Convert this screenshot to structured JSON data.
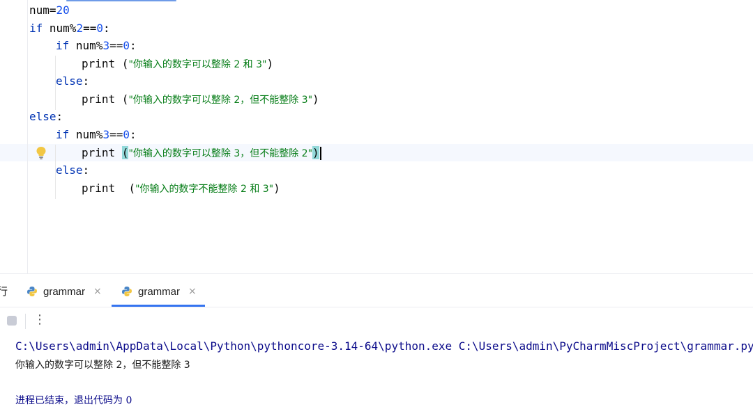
{
  "code_lines": [
    {
      "id": "l1",
      "tokens": [
        {
          "t": "num=",
          "c": "plain"
        },
        {
          "t": "20",
          "c": "num"
        }
      ]
    },
    {
      "id": "l2",
      "tokens": [
        {
          "t": "if ",
          "c": "kw"
        },
        {
          "t": "num%",
          "c": "plain"
        },
        {
          "t": "2",
          "c": "num"
        },
        {
          "t": "==",
          "c": "plain"
        },
        {
          "t": "0",
          "c": "num"
        },
        {
          "t": ":",
          "c": "plain"
        }
      ]
    },
    {
      "id": "l3",
      "tokens": [
        {
          "t": "if ",
          "c": "kw"
        },
        {
          "t": "num%",
          "c": "plain"
        },
        {
          "t": "3",
          "c": "num"
        },
        {
          "t": "==",
          "c": "plain"
        },
        {
          "t": "0",
          "c": "num"
        },
        {
          "t": ":",
          "c": "plain"
        }
      ]
    },
    {
      "id": "l4",
      "tokens": [
        {
          "t": "print ",
          "c": "plain"
        },
        {
          "t": "(",
          "c": "plain"
        },
        {
          "t": "\"你输入的数字可以整除 2 和 3\"",
          "c": "str"
        },
        {
          "t": ")",
          "c": "plain"
        }
      ]
    },
    {
      "id": "l5",
      "tokens": [
        {
          "t": "else",
          "c": "kw"
        },
        {
          "t": ":",
          "c": "plain"
        }
      ]
    },
    {
      "id": "l6",
      "tokens": [
        {
          "t": "print ",
          "c": "plain"
        },
        {
          "t": "(",
          "c": "plain"
        },
        {
          "t": "\"你输入的数字可以整除 2，但不能整除 3\"",
          "c": "str"
        },
        {
          "t": ")",
          "c": "plain"
        }
      ]
    },
    {
      "id": "l7",
      "tokens": [
        {
          "t": "else",
          "c": "kw"
        },
        {
          "t": ":",
          "c": "plain"
        }
      ]
    },
    {
      "id": "l8",
      "tokens": [
        {
          "t": "if ",
          "c": "kw"
        },
        {
          "t": "num%",
          "c": "plain"
        },
        {
          "t": "3",
          "c": "num"
        },
        {
          "t": "==",
          "c": "plain"
        },
        {
          "t": "0",
          "c": "num"
        },
        {
          "t": ":",
          "c": "plain"
        }
      ]
    },
    {
      "id": "l9",
      "tokens": [
        {
          "t": "print ",
          "c": "plain"
        },
        {
          "t": "(",
          "c": "brace"
        },
        {
          "t": "\"你输入的数字可以整除 3，但不能整除 2\"",
          "c": "str"
        },
        {
          "t": ")",
          "c": "brace"
        }
      ]
    },
    {
      "id": "l10",
      "tokens": [
        {
          "t": "else",
          "c": "kw"
        },
        {
          "t": ":",
          "c": "plain"
        }
      ]
    },
    {
      "id": "l11",
      "tokens": [
        {
          "t": "print  ",
          "c": "plain"
        },
        {
          "t": "(",
          "c": "plain"
        },
        {
          "t": "\"你输入的数字不能整除 2 和 3\"",
          "c": "str"
        },
        {
          "t": ")",
          "c": "plain"
        }
      ]
    }
  ],
  "run_panel": {
    "title": "行",
    "tabs": [
      {
        "label": "grammar",
        "icon": "python-icon",
        "close": "×",
        "active": false
      },
      {
        "label": "grammar",
        "icon": "python-icon",
        "close": "×",
        "active": true
      }
    ],
    "toolbar": {
      "more": "⋮"
    }
  },
  "console": {
    "command": "C:\\Users\\admin\\AppData\\Local\\Python\\pythoncore-3.14-64\\python.exe C:\\Users\\admin\\PyCharmMiscProject\\grammar.py",
    "output": "你输入的数字可以整除 2，但不能整除 3",
    "exit": "进程已结束，退出代码为 0"
  },
  "colors": {
    "keyword": "#0033b3",
    "number": "#1750eb",
    "string": "#067d17",
    "accent": "#3574f0"
  }
}
